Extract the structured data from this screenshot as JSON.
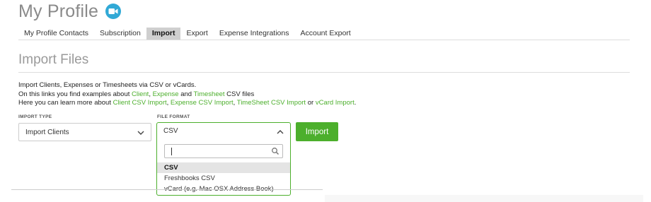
{
  "header": {
    "title": "My Profile",
    "icon": "video-camera-icon",
    "icon_color": "#31a9d6"
  },
  "tabs": [
    {
      "label": "My Profile Contacts",
      "active": false
    },
    {
      "label": "Subscription",
      "active": false
    },
    {
      "label": "Import",
      "active": true
    },
    {
      "label": "Export",
      "active": false
    },
    {
      "label": "Expense Integrations",
      "active": false
    },
    {
      "label": "Account Export",
      "active": false
    }
  ],
  "section": {
    "title": "Import Files"
  },
  "description": {
    "line1": "Import Clients, Expenses or Timesheets via CSV or vCards.",
    "line2_pre": "On this links you find examples about ",
    "link_client": "Client",
    "comma1": ", ",
    "link_expense": "Expense",
    "and": " and ",
    "link_timesheet": "Timesheet",
    "line2_post": " CSV files",
    "line3_pre": "Here you can learn more about ",
    "link_client_csv": "Client CSV Import",
    "comma2": ", ",
    "link_expense_csv": "Expense CSV Import",
    "comma3": ", ",
    "link_timesheet_csv": "TimeSheet CSV Import",
    "or": " or ",
    "link_vcard": "vCard Import",
    "period": "."
  },
  "import_type": {
    "label": "IMPORT TYPE",
    "value": "Import Clients"
  },
  "file_format": {
    "label": "FILE FORMAT",
    "value": "CSV",
    "search_value": "",
    "options": [
      {
        "label": "CSV",
        "highlighted": true
      },
      {
        "label": "Freshbooks CSV",
        "highlighted": false
      },
      {
        "label": "vCard (e.g. Mac OSX Address Book)",
        "highlighted": false
      }
    ]
  },
  "import_button": {
    "label": "Import"
  },
  "colors": {
    "accent": "#4caf2c",
    "tab_active_bg": "#cfcfcf",
    "title_gray": "#8a8a8a"
  }
}
